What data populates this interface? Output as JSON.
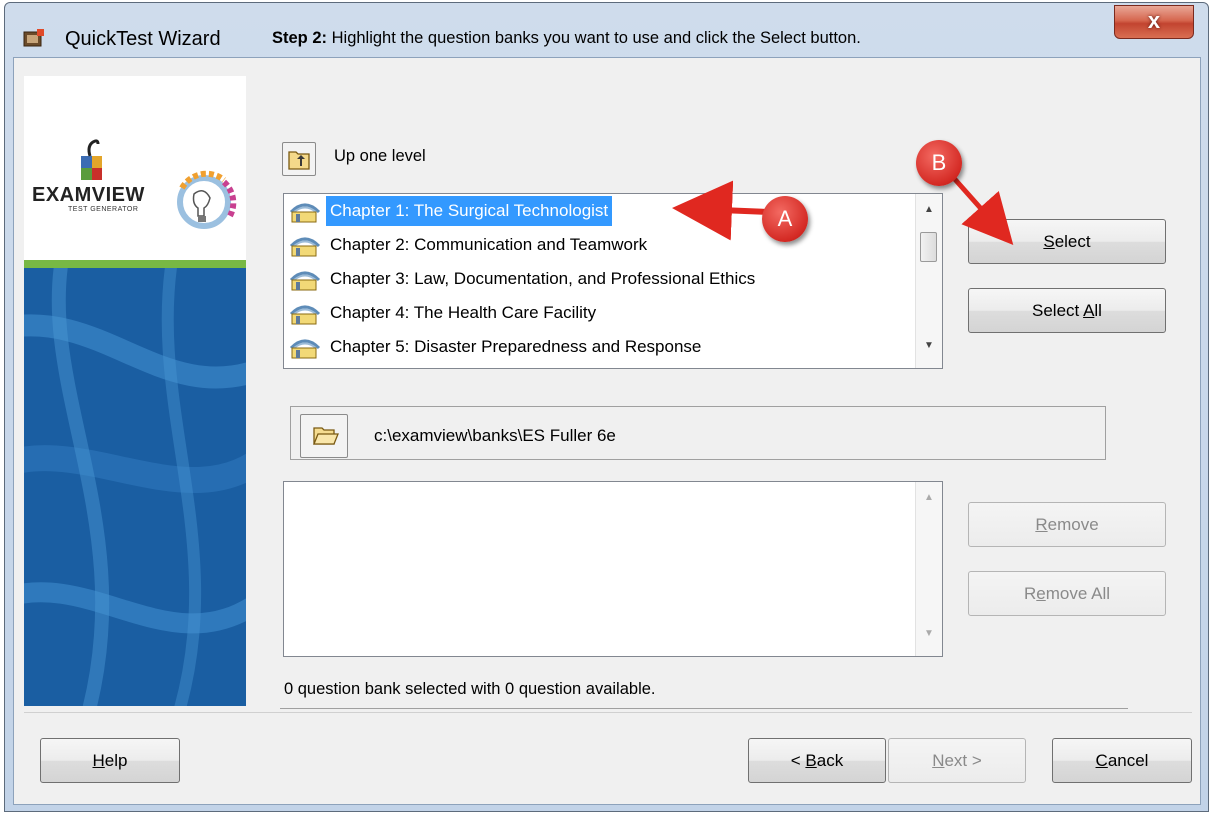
{
  "window": {
    "title": "QuickTest Wizard",
    "close_label": "x"
  },
  "logo": {
    "brand": "EXAMVIEW",
    "subtitle": "TEST GENERATOR"
  },
  "step": {
    "number": "Step 2:",
    "instruction": "Highlight the question banks you want to use and click the Select button."
  },
  "navigation": {
    "up_label": "Up one level"
  },
  "banks": {
    "items": [
      {
        "label": "Chapter 1: The Surgical Technologist",
        "selected": true
      },
      {
        "label": "Chapter 2: Communication and Teamwork",
        "selected": false
      },
      {
        "label": "Chapter 3: Law, Documentation, and Professional Ethics",
        "selected": false
      },
      {
        "label": "Chapter 4: The Health Care Facility",
        "selected": false
      },
      {
        "label": "Chapter 5: Disaster Preparedness and Response",
        "selected": false
      }
    ]
  },
  "buttons": {
    "select": {
      "pre": "",
      "key": "S",
      "post": "elect"
    },
    "select_all": {
      "pre": "Select ",
      "key": "A",
      "post": "ll"
    },
    "remove": {
      "pre": "",
      "key": "R",
      "post": "emove"
    },
    "remove_all": {
      "pre": "R",
      "key": "e",
      "post": "move All"
    },
    "help": {
      "pre": "",
      "key": "H",
      "post": "elp"
    },
    "back": {
      "pre": "< ",
      "key": "B",
      "post": "ack"
    },
    "next": {
      "pre": "",
      "key": "N",
      "post": "ext >"
    },
    "cancel": {
      "pre": "",
      "key": "C",
      "post": "ancel"
    }
  },
  "path": {
    "value": "c:\\examview\\banks\\ES Fuller 6e"
  },
  "selected_banks": {
    "items": []
  },
  "status": {
    "text": "0 question bank selected with 0 question available."
  },
  "annotations": {
    "a": "A",
    "b": "B"
  },
  "colors": {
    "highlight": "#3399ff",
    "callout": "#d42a24",
    "side_panel": "#1a5ea2",
    "accent_green": "#78b844"
  }
}
